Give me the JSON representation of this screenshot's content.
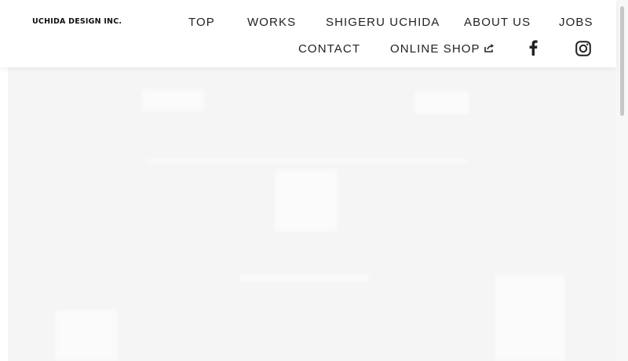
{
  "brand": {
    "logo_text": "UCHIDA DESIGN INC."
  },
  "nav": {
    "top": "TOP",
    "works": "WORKS",
    "shigeru": "SHIGERU UCHIDA",
    "about": "ABOUT US",
    "jobs": "JOBS",
    "contact": "CONTACT",
    "shop": "ONLINE SHOP"
  },
  "social": {
    "facebook_icon": "facebook-icon",
    "instagram_icon": "instagram-icon"
  },
  "colors": {
    "text": "#222222",
    "hero_bg": "#f5f5f5",
    "header_bg": "#ffffff"
  }
}
